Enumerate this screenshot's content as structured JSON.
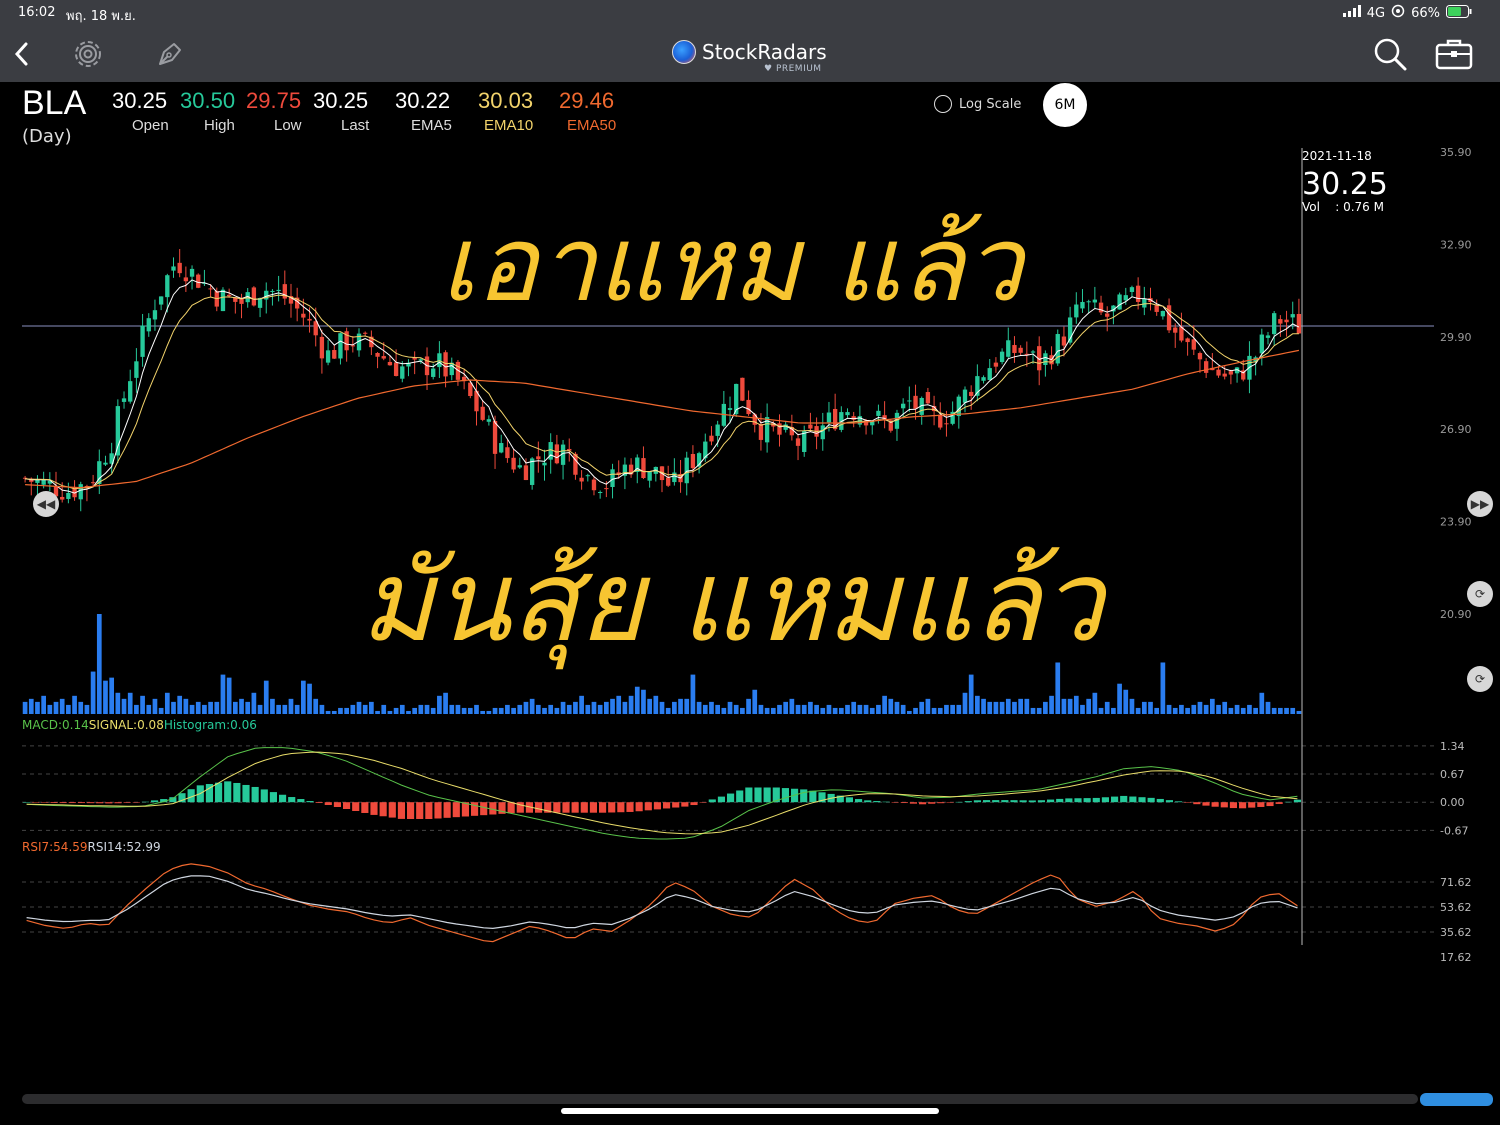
{
  "status": {
    "time": "16:02",
    "date": "พฤ. 18 พ.ย.",
    "network": "4G",
    "battery": "66%"
  },
  "nav": {
    "brand_name": "StockRadars",
    "brand_sub": "PREMIUM"
  },
  "quote": {
    "symbol": "BLA",
    "timeframe": "(Day)",
    "open": {
      "value": "30.25",
      "label": "Open"
    },
    "high": {
      "value": "30.50",
      "label": "High"
    },
    "low": {
      "value": "29.75",
      "label": "Low"
    },
    "last": {
      "value": "30.25",
      "label": "Last"
    },
    "ema5": {
      "value": "30.22",
      "label": "EMA5"
    },
    "ema10": {
      "value": "30.03",
      "label": "EMA10"
    },
    "ema50": {
      "value": "29.46",
      "label": "EMA50"
    }
  },
  "controls": {
    "log_scale_label": "Log Scale",
    "log_scale_checked": false,
    "range_label": "6M"
  },
  "colors": {
    "up": "#26c99a",
    "down": "#ef4a3c",
    "ema5": "#ffffff",
    "ema10": "#f2d36b",
    "ema50": "#f0692f",
    "volume": "#2a7df0",
    "annotation": "#f7c531",
    "macd_line": "#59c24a",
    "signal_line": "#e9dd6a",
    "rsi7": "#f0692f",
    "rsi14": "#cfd6e0",
    "scroll_thumb": "#2f8ee0"
  },
  "crosshair": {
    "date": "2021-11-18",
    "price": "30.25",
    "volume_text": "Vol    : 0.76 M"
  },
  "handwriting": {
    "line1": "เอาแหม แล้ว",
    "line2": "มันสุ้ย แหมแล้ว"
  },
  "indicators": {
    "macd_legend": {
      "macd": "MACD:0.14",
      "signal": "SIGNAL:0.08",
      "histogram": "Histogram:0.06"
    },
    "rsi_legend": {
      "rsi7": "RSI7:54.59",
      "rsi14": "RSI14:52.99"
    }
  },
  "chart_data": [
    {
      "type": "candlestick",
      "title": "BLA (Day)",
      "y_ticks": [
        "35.90",
        "32.90",
        "29.90",
        "26.90",
        "23.90",
        "20.90"
      ],
      "ylim": [
        20.9,
        35.9
      ],
      "reference_line": 30.25,
      "last": {
        "date": "2021-11-18",
        "open": 30.25,
        "high": 30.5,
        "low": 29.75,
        "close": 30.25,
        "volume_m": 0.76
      },
      "close_trend": [
        25.3,
        25.1,
        24.9,
        25.2,
        26.5,
        29.0,
        31.0,
        32.4,
        31.8,
        31.2,
        31.0,
        31.5,
        31.2,
        30.5,
        29.3,
        29.8,
        29.6,
        29.0,
        28.8,
        29.1,
        28.5,
        27.5,
        26.2,
        25.6,
        26.1,
        26.3,
        25.4,
        25.1,
        25.8,
        25.6,
        25.0,
        26.0,
        27.2,
        28.3,
        27.0,
        26.7,
        26.4,
        27.0,
        27.6,
        27.4,
        27.0,
        27.8,
        27.2,
        27.5,
        28.5,
        29.2,
        29.5,
        29.0,
        29.8,
        31.0,
        30.5,
        31.0,
        31.4,
        30.3,
        29.4,
        28.8,
        28.5,
        29.3,
        30.5,
        30.25
      ],
      "ema50_trend": [
        25.1,
        25.0,
        25.2,
        25.8,
        26.6,
        27.3,
        27.9,
        28.3,
        28.5,
        28.4,
        28.1,
        27.8,
        27.5,
        27.3,
        27.1,
        27.1,
        27.3,
        27.4,
        27.6,
        27.9,
        28.2,
        28.7,
        29.1,
        29.46
      ],
      "ema5_last": 30.22,
      "ema10_last": 30.03,
      "ema50_last": 29.46
    },
    {
      "type": "bar",
      "title": "Volume",
      "values": [
        4,
        5,
        4,
        6,
        3,
        4,
        5,
        3,
        6,
        4,
        3,
        14,
        33,
        11,
        12,
        7,
        5,
        7,
        3,
        6,
        3,
        5,
        2,
        7,
        4,
        6,
        5,
        3,
        4,
        3,
        4,
        4,
        13,
        12,
        4,
        5,
        4,
        7,
        3,
        11,
        5,
        3,
        3,
        5,
        3,
        11,
        10,
        5,
        3,
        1,
        1,
        2,
        2,
        3,
        4,
        3,
        4,
        1,
        3,
        1,
        2,
        3,
        1,
        2,
        3,
        3,
        2,
        6,
        7,
        3,
        3,
        2,
        2,
        3,
        1,
        1,
        2,
        2,
        3,
        2,
        3,
        4,
        5,
        3,
        2,
        3,
        2,
        4,
        3,
        4,
        6,
        3,
        4,
        3,
        4,
        5,
        6,
        4,
        6,
        9,
        8,
        5,
        6,
        4,
        2,
        4,
        5,
        5,
        13,
        4,
        3,
        4,
        3,
        2,
        4,
        3,
        2,
        5,
        8,
        3,
        2,
        2,
        3,
        4,
        5,
        3,
        3,
        4,
        3,
        2,
        3,
        2,
        2,
        3,
        4,
        3,
        3,
        2,
        3,
        6,
        5,
        4,
        3,
        1,
        2,
        4,
        5,
        2,
        2,
        3,
        3,
        3,
        7,
        13,
        6,
        5,
        4,
        4,
        4,
        5,
        4,
        5,
        5,
        2,
        2,
        4,
        6,
        17,
        5,
        5,
        6,
        3,
        5,
        7,
        2,
        4,
        2,
        10,
        8,
        5,
        2,
        4,
        4,
        2,
        17,
        3,
        2,
        3,
        2,
        3,
        4,
        3,
        5,
        3,
        4,
        2,
        3,
        2,
        3,
        2,
        7,
        4,
        2,
        2,
        2,
        2,
        1
      ]
    },
    {
      "type": "line",
      "title": "MACD",
      "y_ticks": [
        "1.34",
        "0.67",
        "0.00",
        "-0.67"
      ],
      "ylim": [
        -0.9,
        1.6
      ],
      "macd": [
        -0.05,
        -0.08,
        -0.1,
        -0.12,
        -0.1,
        0.05,
        0.6,
        1.1,
        1.3,
        1.3,
        1.2,
        1.0,
        0.7,
        0.4,
        0.15,
        0.0,
        -0.15,
        -0.3,
        -0.45,
        -0.6,
        -0.75,
        -0.85,
        -0.88,
        -0.85,
        -0.6,
        -0.2,
        0.05,
        0.25,
        0.3,
        0.25,
        0.2,
        0.1,
        0.12,
        0.2,
        0.25,
        0.3,
        0.45,
        0.6,
        0.8,
        0.85,
        0.75,
        0.5,
        0.2,
        0.05,
        0.14
      ],
      "signal": [
        -0.05,
        -0.06,
        -0.08,
        -0.09,
        -0.1,
        -0.05,
        0.2,
        0.6,
        0.95,
        1.15,
        1.2,
        1.15,
        1.0,
        0.8,
        0.55,
        0.35,
        0.15,
        -0.05,
        -0.2,
        -0.35,
        -0.5,
        -0.62,
        -0.72,
        -0.76,
        -0.72,
        -0.55,
        -0.3,
        -0.05,
        0.12,
        0.2,
        0.2,
        0.15,
        0.13,
        0.15,
        0.2,
        0.26,
        0.36,
        0.5,
        0.65,
        0.75,
        0.74,
        0.6,
        0.35,
        0.15,
        0.08
      ],
      "histogram_last": 0.06
    },
    {
      "type": "line",
      "title": "RSI",
      "y_ticks": [
        "71.62",
        "53.62",
        "35.62",
        "17.62"
      ],
      "ylim": [
        17.62,
        89.62
      ],
      "rsi7": [
        44,
        40,
        38,
        42,
        40,
        55,
        68,
        80,
        85,
        83,
        78,
        70,
        66,
        60,
        55,
        52,
        50,
        45,
        42,
        46,
        40,
        36,
        32,
        28,
        34,
        40,
        36,
        30,
        38,
        36,
        45,
        56,
        72,
        66,
        54,
        48,
        46,
        60,
        74,
        66,
        52,
        44,
        42,
        56,
        60,
        62,
        52,
        48,
        56,
        64,
        72,
        78,
        60,
        54,
        58,
        66,
        46,
        42,
        40,
        36,
        42,
        60,
        64,
        54.59
      ],
      "rsi14": [
        46,
        44,
        43,
        44,
        44,
        52,
        62,
        72,
        76,
        76,
        72,
        66,
        63,
        59,
        56,
        54,
        52,
        49,
        47,
        48,
        45,
        42,
        40,
        38,
        40,
        43,
        41,
        38,
        42,
        41,
        46,
        53,
        63,
        60,
        54,
        51,
        50,
        57,
        65,
        61,
        55,
        50,
        49,
        55,
        57,
        58,
        54,
        51,
        55,
        59,
        64,
        68,
        60,
        56,
        57,
        61,
        52,
        48,
        46,
        44,
        47,
        56,
        58,
        52.99
      ]
    }
  ]
}
